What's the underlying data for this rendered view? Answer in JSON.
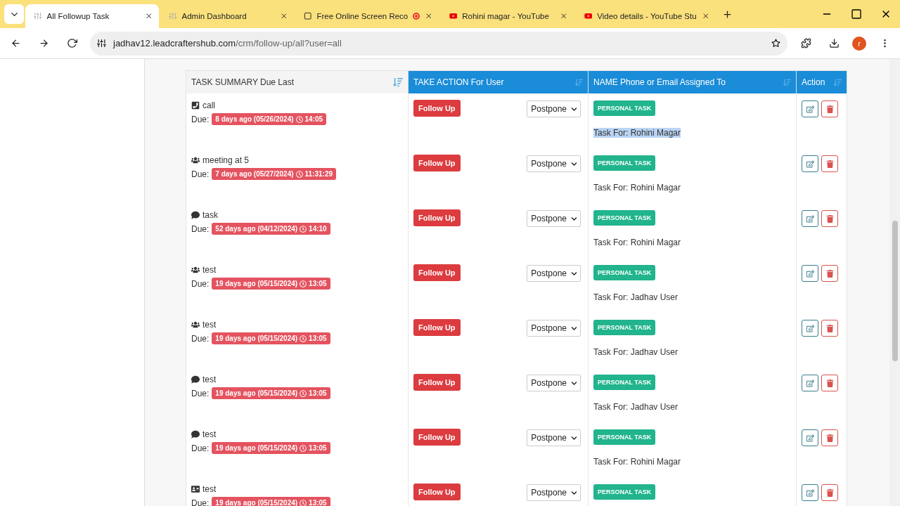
{
  "browser": {
    "tabs": [
      {
        "title": "All Followup Task",
        "selected": true,
        "kind": "site"
      },
      {
        "title": "Admin Dashboard",
        "selected": false,
        "kind": "site"
      },
      {
        "title": "Free Online Screen Reco",
        "selected": false,
        "kind": "recorder",
        "recording": true
      },
      {
        "title": "Rohini magar - YouTube",
        "selected": false,
        "kind": "youtube"
      },
      {
        "title": "Video details - YouTube Stu",
        "selected": false,
        "kind": "youtube"
      }
    ],
    "url_host": "jadhav12.leadcraftershub.com",
    "url_path": "/crm/follow-up/all?user=all",
    "profile_initial": "r"
  },
  "table": {
    "columns": [
      {
        "label": "TASK SUMMARY Due Last",
        "kind": "summary"
      },
      {
        "label": "TAKE ACTION For User",
        "kind": "sort"
      },
      {
        "label": "NAME Phone or Email Assigned To",
        "kind": "sort"
      },
      {
        "label": "Action",
        "kind": "sort"
      }
    ],
    "rows": [
      {
        "kind": "phone",
        "title": "call",
        "due_label": "Due:",
        "due": "8 days ago (05/26/2024)",
        "time": "14:05",
        "follow_up": "Follow Up",
        "postpone": "Postpone",
        "tag": "PERSONAL TASK",
        "task_for": "Task For: Rohini Magar",
        "highlighted": true
      },
      {
        "kind": "group",
        "title": "meeting at 5",
        "due_label": "Due:",
        "due": "7 days ago (05/27/2024)",
        "time": "11:31:29",
        "follow_up": "Follow Up",
        "postpone": "Postpone",
        "tag": "PERSONAL TASK",
        "task_for": "Task For: Rohini Magar",
        "highlighted": false
      },
      {
        "kind": "comment",
        "title": "task",
        "due_label": "Due:",
        "due": "52 days ago (04/12/2024)",
        "time": "14:10",
        "follow_up": "Follow Up",
        "postpone": "Postpone",
        "tag": "PERSONAL TASK",
        "task_for": "Task For: Rohini Magar",
        "highlighted": false
      },
      {
        "kind": "group",
        "title": "test",
        "due_label": "Due:",
        "due": "19 days ago (05/15/2024)",
        "time": "13:05",
        "follow_up": "Follow Up",
        "postpone": "Postpone",
        "tag": "PERSONAL TASK",
        "task_for": "Task For: Jadhav User",
        "highlighted": false
      },
      {
        "kind": "group",
        "title": "test",
        "due_label": "Due:",
        "due": "19 days ago (05/15/2024)",
        "time": "13:05",
        "follow_up": "Follow Up",
        "postpone": "Postpone",
        "tag": "PERSONAL TASK",
        "task_for": "Task For: Jadhav User",
        "highlighted": false
      },
      {
        "kind": "comment",
        "title": "test",
        "due_label": "Due:",
        "due": "19 days ago (05/15/2024)",
        "time": "13:05",
        "follow_up": "Follow Up",
        "postpone": "Postpone",
        "tag": "PERSONAL TASK",
        "task_for": "Task For: Jadhav User",
        "highlighted": false
      },
      {
        "kind": "comment",
        "title": "test",
        "due_label": "Due:",
        "due": "19 days ago (05/15/2024)",
        "time": "13:05",
        "follow_up": "Follow Up",
        "postpone": "Postpone",
        "tag": "PERSONAL TASK",
        "task_for": "Task For: Rohini Magar",
        "highlighted": false
      },
      {
        "kind": "card",
        "title": "test",
        "due_label": "Due:",
        "due": "19 days ago (05/15/2024)",
        "time": "13:05",
        "follow_up": "Follow Up",
        "postpone": "Postpone",
        "tag": "PERSONAL TASK",
        "task_for": null,
        "highlighted": false
      }
    ]
  }
}
